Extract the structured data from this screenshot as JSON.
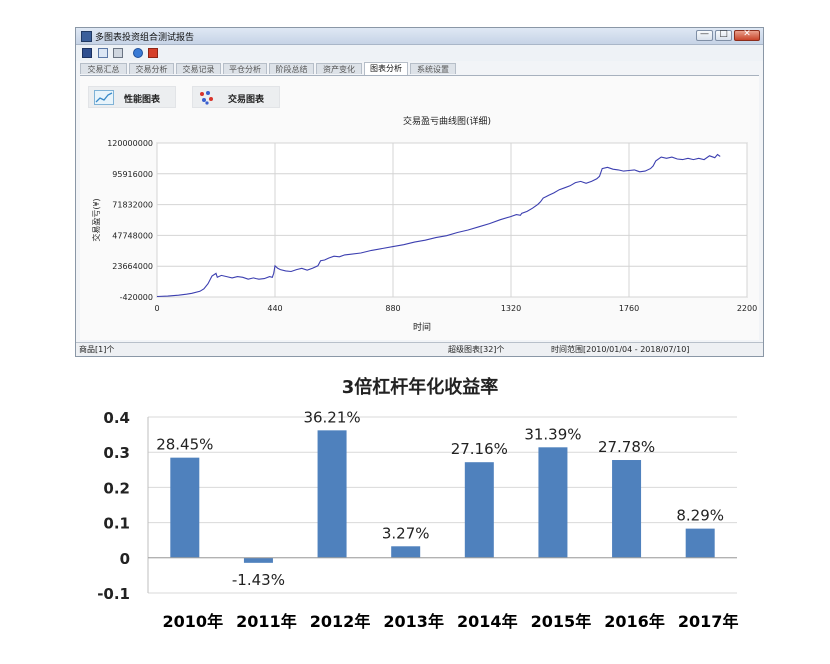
{
  "window": {
    "title": "多图表投资组合测试报告",
    "controls": [
      "—",
      "□",
      "✕"
    ]
  },
  "toolbar": {
    "icons": [
      "save-icon",
      "copy-icon",
      "print-icon",
      "help-icon",
      "close-icon"
    ]
  },
  "tabs": [
    "交易汇总",
    "交易分析",
    "交易记录",
    "平仓分析",
    "阶段总结",
    "资产变化",
    "图表分析",
    "系统设置"
  ],
  "active_tab": 6,
  "chart_buttons": [
    {
      "label": "性能图表",
      "icon": "line-chart-icon"
    },
    {
      "label": "交易图表",
      "icon": "scatter-chart-icon"
    }
  ],
  "statusbar": {
    "products": "商品[1]个",
    "charts": "超级图表[32]个",
    "range": "时间范围[2010/01/04 - 2018/07/10]"
  },
  "colors": {
    "line": "#3c3fb0",
    "bar": "#4f81bd"
  },
  "chart_data": [
    {
      "type": "line",
      "title": "交易盈亏曲线图(详细)",
      "xlabel": "时间",
      "ylabel": "交易盈亏(¥)",
      "xlim": [
        0,
        2200
      ],
      "ylim": [
        -420000,
        120000000
      ],
      "xticks": [
        0,
        440,
        880,
        1320,
        1760,
        2200
      ],
      "yticks": [
        "-420000",
        "23664000",
        "47748000",
        "71832000",
        "95916000",
        "120000000"
      ],
      "grid": true,
      "series": [
        {
          "x": [
            0,
            40,
            80,
            110,
            130,
            160,
            175,
            190,
            205,
            220,
            225,
            240,
            260,
            280,
            300,
            320,
            340,
            360,
            370,
            380,
            400,
            420,
            430,
            435,
            440,
            450,
            460,
            480,
            500,
            520,
            540,
            560,
            580,
            600,
            610,
            625,
            640,
            660,
            680,
            700,
            720,
            760,
            800,
            840,
            880,
            920,
            960,
            1000,
            1040,
            1080,
            1120,
            1160,
            1200,
            1240,
            1280,
            1320,
            1340,
            1355,
            1360,
            1380,
            1400,
            1420,
            1430,
            1440,
            1450,
            1460,
            1480,
            1500,
            1520,
            1540,
            1560,
            1580,
            1600,
            1620,
            1640,
            1650,
            1660,
            1680,
            1700,
            1720,
            1740,
            1760,
            1780,
            1800,
            1820,
            1840,
            1850,
            1860,
            1880,
            1900,
            1920,
            1940,
            1960,
            1980,
            2000,
            2020,
            2040,
            2060,
            2080,
            2090,
            2100
          ],
          "y": [
            0,
            300000,
            1000000,
            1800000,
            2500000,
            4000000,
            6000000,
            10000000,
            16000000,
            18000000,
            15000000,
            16500000,
            15500000,
            14500000,
            15500000,
            15000000,
            13500000,
            14500000,
            14000000,
            13500000,
            14000000,
            15500000,
            15000000,
            18000000,
            24000000,
            22000000,
            21000000,
            20000000,
            19500000,
            21000000,
            22000000,
            20500000,
            22000000,
            24000000,
            28000000,
            28500000,
            30000000,
            31500000,
            31000000,
            32500000,
            33000000,
            34000000,
            36000000,
            37500000,
            39000000,
            40500000,
            42500000,
            44000000,
            46000000,
            47500000,
            50000000,
            52000000,
            54500000,
            57000000,
            60000000,
            62500000,
            64000000,
            63500000,
            65000000,
            66500000,
            69000000,
            72000000,
            74000000,
            77000000,
            78000000,
            79000000,
            81000000,
            83500000,
            85000000,
            86500000,
            89000000,
            90000000,
            88500000,
            90000000,
            92000000,
            94000000,
            100000000,
            101000000,
            99500000,
            99000000,
            98000000,
            98500000,
            99000000,
            97500000,
            98000000,
            100000000,
            102000000,
            106000000,
            109000000,
            108000000,
            109000000,
            107500000,
            107000000,
            108000000,
            107000000,
            108000000,
            107000000,
            110000000,
            108500000,
            111000000,
            109500000
          ]
        }
      ]
    },
    {
      "type": "bar",
      "title": "3倍杠杆年化收益率",
      "categories": [
        "2010年",
        "2011年",
        "2012年",
        "2013年",
        "2014年",
        "2015年",
        "2016年",
        "2017年"
      ],
      "values": [
        0.2845,
        -0.0143,
        0.3621,
        0.0327,
        0.2716,
        0.3139,
        0.2778,
        0.0829
      ],
      "data_labels": [
        "28.45%",
        "-1.43%",
        "36.21%",
        "3.27%",
        "27.16%",
        "31.39%",
        "27.78%",
        "8.29%"
      ],
      "ylim": [
        -0.1,
        0.4
      ],
      "yticks": [
        "-0.1",
        "0",
        "0.1",
        "0.2",
        "0.3",
        "0.4"
      ],
      "grid": true
    }
  ]
}
